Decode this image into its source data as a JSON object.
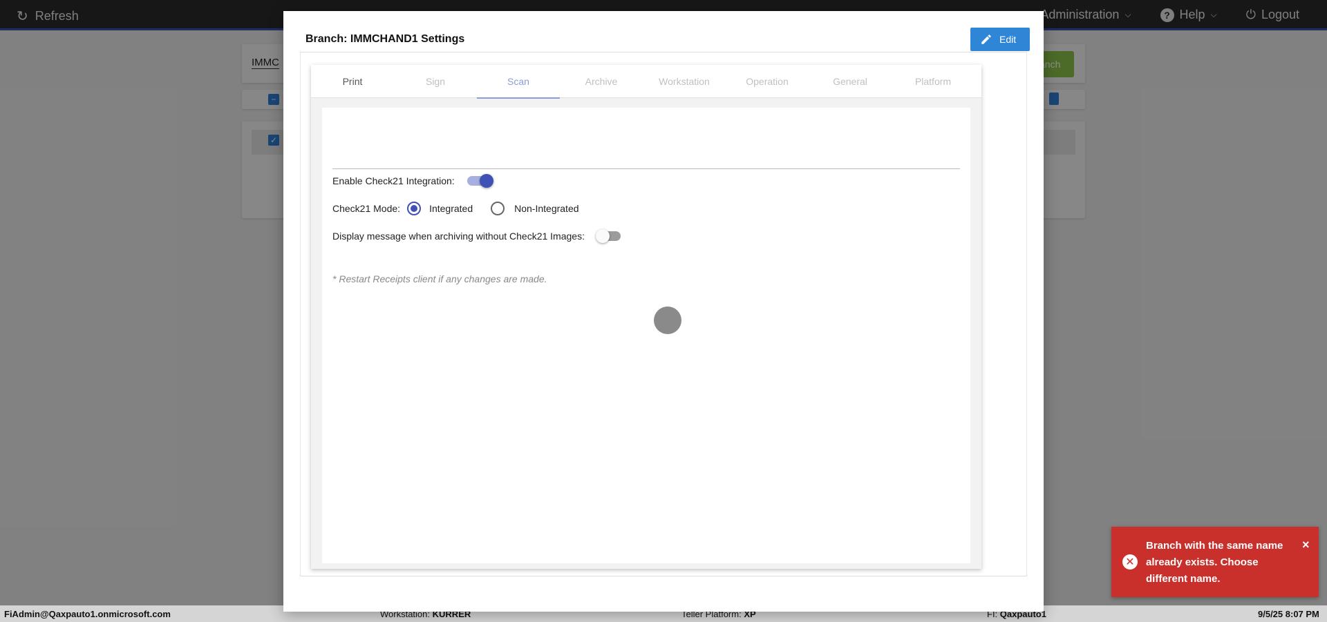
{
  "topbar": {
    "refresh_label": "Refresh",
    "administration_label": "Administration",
    "help_label": "Help",
    "logout_label": "Logout"
  },
  "background": {
    "search_value": "IMMC",
    "green_button_label": "anch"
  },
  "modal": {
    "title": "Branch: IMMCHAND1 Settings",
    "edit_label": "Edit",
    "tabs": [
      {
        "label": "Print"
      },
      {
        "label": "Sign"
      },
      {
        "label": "Scan"
      },
      {
        "label": "Archive"
      },
      {
        "label": "Workstation"
      },
      {
        "label": "Operation"
      },
      {
        "label": "General"
      },
      {
        "label": "Platform"
      }
    ],
    "active_tab": "Scan",
    "scan": {
      "enable_check21_label": "Enable Check21 Integration:",
      "enable_check21_value": true,
      "mode_label": "Check21 Mode:",
      "mode_options": [
        "Integrated",
        "Non-Integrated"
      ],
      "mode_selected": "Integrated",
      "display_message_label": "Display message when archiving without Check21 Images:",
      "display_message_value": false,
      "note": "* Restart Receipts client if any changes are made."
    }
  },
  "toast": {
    "message": "Branch with the same name already exists. Choose different name.",
    "close_symbol": "×"
  },
  "footer": {
    "user": "FiAdmin@Qaxpauto1.onmicrosoft.com",
    "workstation_label": "Workstation:",
    "workstation_value": "KURRER",
    "teller_label": "Teller Platform:",
    "teller_value": "XP",
    "fi_label": "FI:",
    "fi_value": "Qaxpauto1",
    "datetime": "9/5/25 8:07 PM"
  },
  "colors": {
    "accent": "#3f51b5",
    "edit_button": "#2f86d6",
    "toast_error": "#c9302c",
    "topbar": "#2b2b2b"
  }
}
